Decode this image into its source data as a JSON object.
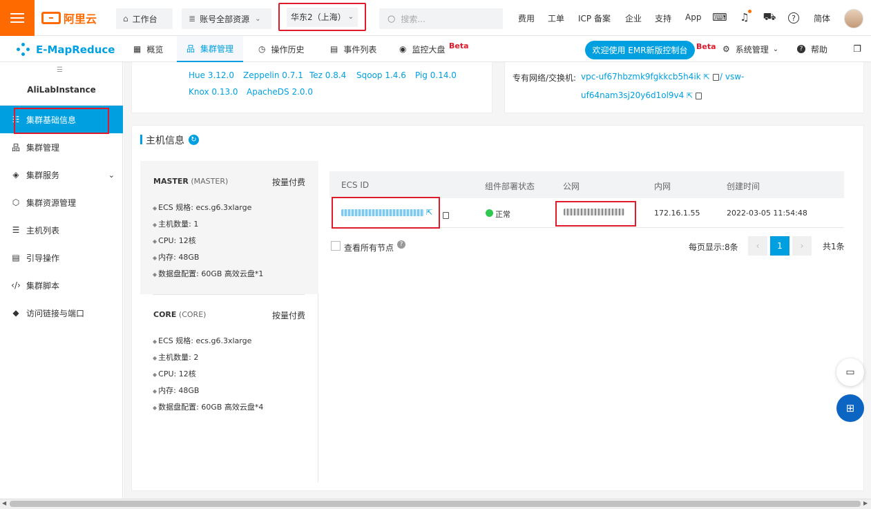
{
  "topbar": {
    "logo_text": "阿里云",
    "workbench": "工作台",
    "resources": "账号全部资源",
    "region": "华东2（上海）",
    "search_placeholder": "搜索...",
    "nav": [
      "费用",
      "工单",
      "ICP 备案",
      "企业",
      "支持",
      "App"
    ],
    "lang": "简体"
  },
  "subbar": {
    "product": "E-MapReduce",
    "tabs": [
      "概览",
      "集群管理",
      "操作历史",
      "事件列表",
      "监控大盘"
    ],
    "beta": "Beta",
    "welcome": "欢迎使用 EMR新版控制台",
    "system": "系统管理",
    "help": "帮助"
  },
  "sidebar": {
    "instance": "AliLabInstance",
    "items": [
      "集群基础信息",
      "集群管理",
      "集群服务",
      "集群资源管理",
      "主机列表",
      "引导操作",
      "集群脚本",
      "访问链接与端口"
    ]
  },
  "software": {
    "row1": [
      "Hue 3.12.0",
      "Zeppelin 0.7.1",
      "Tez 0.8.4",
      "Sqoop 1.4.6",
      "Pig 0.14.0"
    ],
    "row2": [
      "Knox 0.13.0",
      "ApacheDS 2.0.0"
    ]
  },
  "network": {
    "label": "专有网络/交换机:",
    "vpc": "vpc-uf67hbzmk9fgkkcb5h4ik",
    "vsw_part1": "vsw-",
    "vsw_part2": "uf64nam3sj20y6d1ol9v4"
  },
  "host": {
    "title": "主机信息",
    "groups": [
      {
        "name": "MASTER",
        "type": "(MASTER)",
        "pay": "按量付费",
        "rows": [
          "ECS 规格: ecs.g6.3xlarge",
          "主机数量: 1",
          "CPU: 12核",
          "内存: 48GB",
          "数据盘配置: 60GB 高效云盘*1"
        ]
      },
      {
        "name": "CORE",
        "type": "(CORE)",
        "pay": "按量付费",
        "rows": [
          "ECS 规格: ecs.g6.3xlarge",
          "主机数量: 2",
          "CPU: 12核",
          "内存: 48GB",
          "数据盘配置: 60GB 高效云盘*4"
        ]
      }
    ],
    "table": {
      "headers": [
        "ECS ID",
        "组件部署状态",
        "公网",
        "内网",
        "创建时间"
      ],
      "row": {
        "status": "正常",
        "private_ip": "172.16.1.55",
        "created": "2022-03-05 11:54:48"
      }
    },
    "show_all": "查看所有节点",
    "page_size": "每页显示:8条",
    "page": "1",
    "total": "共1条"
  },
  "colors": {
    "brand": "#ff6a00",
    "accent": "#00a0e0",
    "highlight": "#e0192b",
    "ok": "#2dc84d"
  }
}
